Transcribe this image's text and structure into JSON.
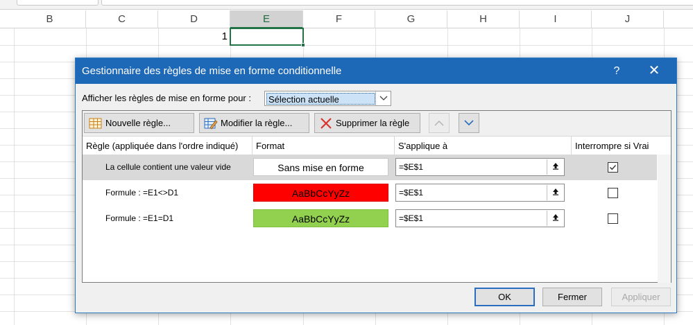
{
  "sheet": {
    "columns": [
      "B",
      "C",
      "D",
      "E",
      "F",
      "G",
      "H",
      "I",
      "J"
    ],
    "active_column": "E",
    "cell_d1_value": "1"
  },
  "dialog": {
    "title": "Gestionnaire des règles de mise en forme conditionnelle",
    "help_label": "?",
    "close_label": "✕",
    "show_rules_label": "Afficher les règles de mise en forme pour :",
    "show_rules_value": "Sélection actuelle",
    "toolbar": {
      "new_rule": "Nouvelle règle...",
      "edit_rule": "Modifier la règle...",
      "delete_rule": "Supprimer la règle",
      "move_up": "∧",
      "move_down": "∨"
    },
    "columns": {
      "rule": "Règle (appliquée dans l'ordre indiqué)",
      "format": "Format",
      "applies_to": "S'applique à",
      "stop_if_true": "Interrompre si Vrai"
    },
    "rules": [
      {
        "name": "La cellule contient une valeur vide",
        "format_preview": "Sans mise en forme",
        "format_bg": "#ffffff",
        "applies_to": "=$E$1",
        "stop_if_true": true,
        "selected": true
      },
      {
        "name": "Formule : =E1<>D1",
        "format_preview": "AaBbCcYyZz",
        "format_bg": "#ff0000",
        "applies_to": "=$E$1",
        "stop_if_true": false,
        "selected": false
      },
      {
        "name": "Formule : =E1=D1",
        "format_preview": "AaBbCcYyZz",
        "format_bg": "#92d050",
        "applies_to": "=$E$1",
        "stop_if_true": false,
        "selected": false
      }
    ],
    "buttons": {
      "ok": "OK",
      "close": "Fermer",
      "apply": "Appliquer"
    }
  }
}
